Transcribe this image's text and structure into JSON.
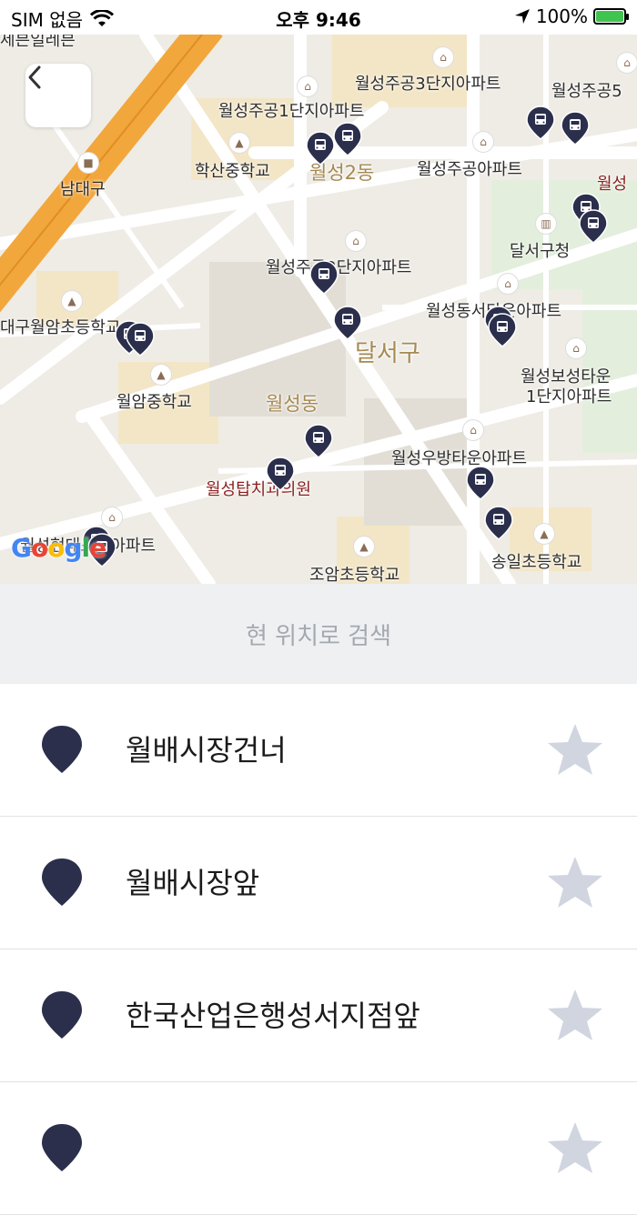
{
  "status": {
    "carrier": "SIM 없음",
    "time": "오후 9:46",
    "battery": "100%"
  },
  "map": {
    "labels": [
      "세븐일레븐",
      "남대구",
      "학산중학교",
      "월성주공1단지아파트",
      "월성주공3단지아파트",
      "월성주공5",
      "월성2동",
      "월성주공아파트",
      "월성",
      "달서구청",
      "월성주공2단지아파트",
      "대구월암초등학교",
      "월성동서타운아파트",
      "달서구",
      "월암중학교",
      "월성동",
      "월성보성타운",
      "1단지아파트",
      "월성우방타운아파트",
      "월성탑치과의원",
      "월성현대포레아파트",
      "조암초등학교",
      "송일초등학교"
    ],
    "attribution": "Google"
  },
  "search": {
    "label": "현 위치로 검색"
  },
  "stops": [
    {
      "name": "월배시장건너"
    },
    {
      "name": "월배시장앞"
    },
    {
      "name": "한국산업은행성서지점앞"
    },
    {
      "name": ""
    }
  ],
  "colors": {
    "pin": "#2b2f4c",
    "star": "#d1d5e0",
    "highway": "#f2a73c",
    "search_bg": "#eff0f2"
  }
}
